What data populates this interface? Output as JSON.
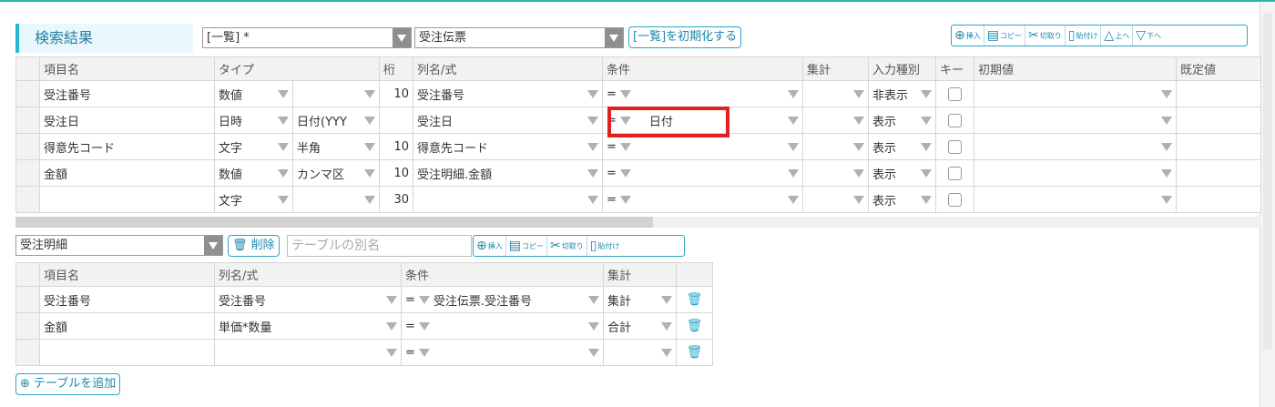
{
  "header": {
    "title": "検索結果",
    "list_select": "[一覧] *",
    "form_select": "受注伝票",
    "reset_button": "[一覧]を初期化する",
    "tools": [
      {
        "icon": "plus-circle-icon",
        "glyph": "⊕",
        "label": "挿入"
      },
      {
        "icon": "copy-icon",
        "glyph": "▤",
        "label": "コピー"
      },
      {
        "icon": "scissors-icon",
        "glyph": "✂",
        "label": "切取り"
      },
      {
        "icon": "paste-icon",
        "glyph": "▯",
        "label": "貼付け"
      },
      {
        "icon": "up-icon",
        "glyph": "△",
        "label": "上へ"
      },
      {
        "icon": "down-icon",
        "glyph": "▽",
        "label": "下へ"
      }
    ]
  },
  "main_grid": {
    "columns": [
      "項目名",
      "タイプ",
      "桁",
      "列名/式",
      "条件",
      "集計",
      "入力種別",
      "キー",
      "初期値",
      "既定値"
    ],
    "rows": [
      {
        "name": "受注番号",
        "type": "数値",
        "subtype": "",
        "digits": "10",
        "column": "受注番号",
        "op": "=",
        "cond": "",
        "agg": "",
        "input": "非表示"
      },
      {
        "name": "受注日",
        "type": "日時",
        "subtype": "日付(YYY",
        "digits": "",
        "column": "受注日",
        "op": "=",
        "cond": "日付",
        "agg": "",
        "input": "表示"
      },
      {
        "name": "得意先コード",
        "type": "文字",
        "subtype": "半角",
        "digits": "10",
        "column": "得意先コード",
        "op": "=",
        "cond": "",
        "agg": "",
        "input": "表示"
      },
      {
        "name": "金額",
        "type": "数値",
        "subtype": "カンマ区",
        "digits": "10",
        "column": "受注明細.金額",
        "op": "=",
        "cond": "",
        "agg": "",
        "input": "表示"
      },
      {
        "name": "",
        "type": "文字",
        "subtype": "",
        "digits": "30",
        "column": "",
        "op": "=",
        "cond": "",
        "agg": "",
        "input": "表示"
      }
    ]
  },
  "sub_section": {
    "table_select": "受注明細",
    "delete_button": "削除",
    "alias_placeholder": "テーブルの別名",
    "tools": [
      {
        "icon": "plus-circle-icon",
        "glyph": "⊕",
        "label": "挿入"
      },
      {
        "icon": "copy-icon",
        "glyph": "▤",
        "label": "コピー"
      },
      {
        "icon": "scissors-icon",
        "glyph": "✂",
        "label": "切取り"
      },
      {
        "icon": "paste-icon",
        "glyph": "▯",
        "label": "貼付け"
      }
    ]
  },
  "sub_grid": {
    "columns": [
      "項目名",
      "列名/式",
      "条件",
      "集計"
    ],
    "rows": [
      {
        "name": "受注番号",
        "column": "受注番号",
        "op": "=",
        "cond": "受注伝票.受注番号",
        "agg": "集計"
      },
      {
        "name": "金額",
        "column": "単価*数量",
        "op": "=",
        "cond": "",
        "agg": "合計"
      },
      {
        "name": "",
        "column": "",
        "op": "=",
        "cond": "",
        "agg": ""
      }
    ]
  },
  "add_table_button": "テーブルを追加",
  "colors": {
    "accent": "#29b6cf",
    "highlight": "#e32020",
    "header_bg": "#f2f2f2"
  }
}
